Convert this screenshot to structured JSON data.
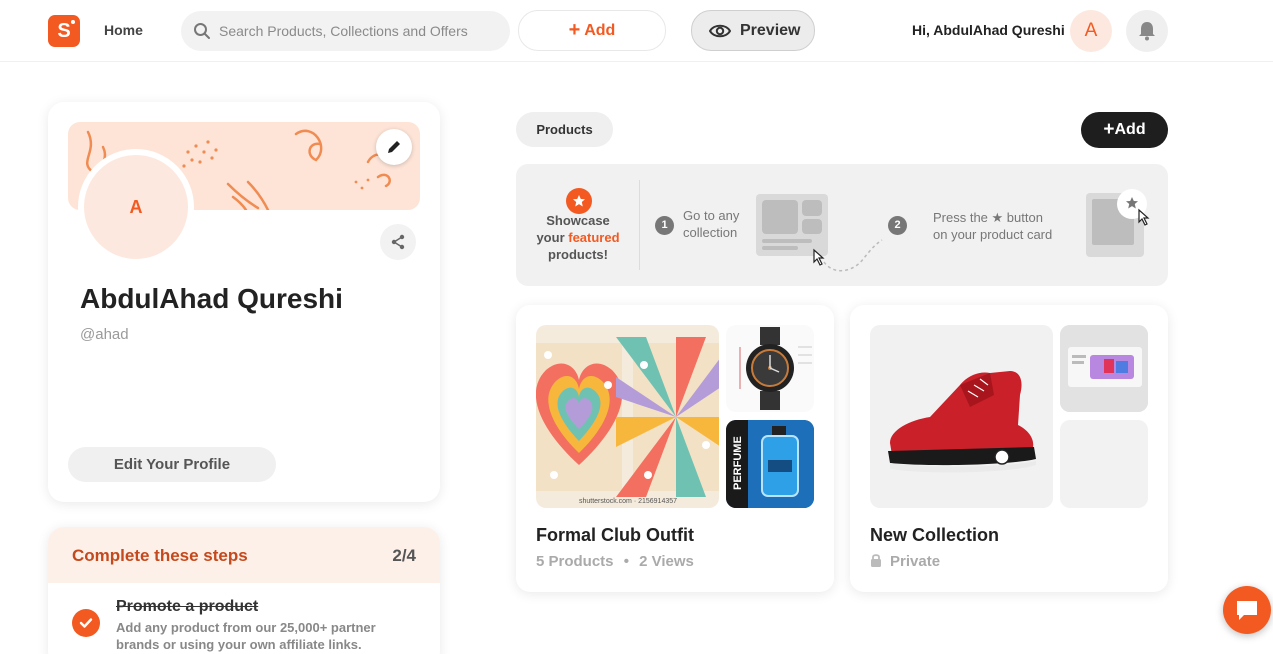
{
  "header": {
    "logo_letter": "S",
    "home_label": "Home",
    "search_placeholder": "Search Products, Collections and Offers",
    "add_label": "Add",
    "preview_label": "Preview",
    "greeting": "Hi, AbdulAhad Qureshi",
    "avatar_letter": "A"
  },
  "profile": {
    "avatar_letter": "A",
    "name": "AbdulAhad Qureshi",
    "handle": "@ahad",
    "edit_profile_label": "Edit Your Profile"
  },
  "steps": {
    "title": "Complete these steps",
    "count": "2/4",
    "items": [
      {
        "title": "Promote a product",
        "description": "Add any product from our 25,000+ partner brands or using your own affiliate links."
      }
    ]
  },
  "products": {
    "chip_label": "Products",
    "add_label": "Add",
    "showcase": {
      "line1": "Showcase",
      "line2_pre": "your ",
      "line2_highlight": "featured",
      "line3": "products!",
      "step1_number": "1",
      "step1_line1": "Go to any",
      "step1_line2": "collection",
      "step2_number": "2",
      "step2_line1": "Press the ★ button",
      "step2_line2": "on your product card"
    },
    "collections": [
      {
        "name": "Formal Club Outfit",
        "products": "5 Products",
        "views": "2 Views",
        "watermark": "shutterstock.com · 2156914357",
        "perfume_label": "PERFUME"
      },
      {
        "name": "New Collection",
        "status": "Private"
      }
    ]
  },
  "colors": {
    "brand": "#f25a22",
    "dark_button": "#1e1e1e"
  },
  "icons": {
    "search": "search-icon",
    "plus": "plus-icon",
    "eye": "eye-icon",
    "bell": "bell-icon",
    "pencil": "pencil-icon",
    "share": "share-icon",
    "check": "check-icon",
    "star": "star-icon",
    "lock": "lock-icon",
    "chat": "chat-icon"
  }
}
